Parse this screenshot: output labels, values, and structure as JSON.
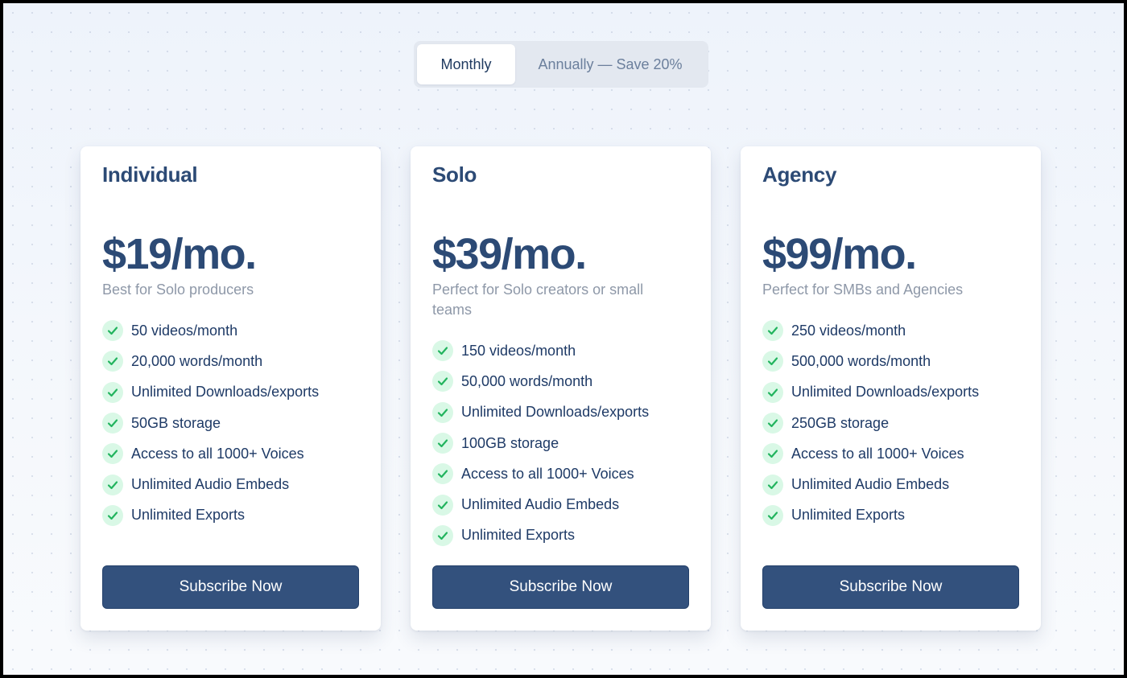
{
  "billing_toggle": {
    "monthly_label": "Monthly",
    "annually_label": "Annually — Save 20%",
    "selected": "Monthly"
  },
  "colors": {
    "primary": "#33517d",
    "heading": "#2c4a75",
    "check_bg": "#d9f8e6",
    "check_mark": "#22b45e",
    "muted": "#8e98a8"
  },
  "plans": [
    {
      "name": "Individual",
      "price": "$19/mo.",
      "description": "Best for Solo producers",
      "features": [
        "50 videos/month",
        "20,000 words/month",
        "Unlimited Downloads/exports",
        "50GB storage",
        "Access to all 1000+ Voices",
        "Unlimited Audio Embeds",
        "Unlimited Exports"
      ],
      "cta": "Subscribe Now"
    },
    {
      "name": "Solo",
      "price": "$39/mo.",
      "description": "Perfect for Solo creators or small teams",
      "features": [
        "150 videos/month",
        "50,000 words/month",
        "Unlimited Downloads/exports",
        "100GB storage",
        "Access to all 1000+ Voices",
        "Unlimited Audio Embeds",
        "Unlimited Exports"
      ],
      "cta": "Subscribe Now"
    },
    {
      "name": "Agency",
      "price": "$99/mo.",
      "description": "Perfect for SMBs and Agencies",
      "features": [
        "250 videos/month",
        "500,000 words/month",
        "Unlimited Downloads/exports",
        "250GB storage",
        "Access to all 1000+ Voices",
        "Unlimited Audio Embeds",
        "Unlimited Exports"
      ],
      "cta": "Subscribe Now"
    }
  ]
}
